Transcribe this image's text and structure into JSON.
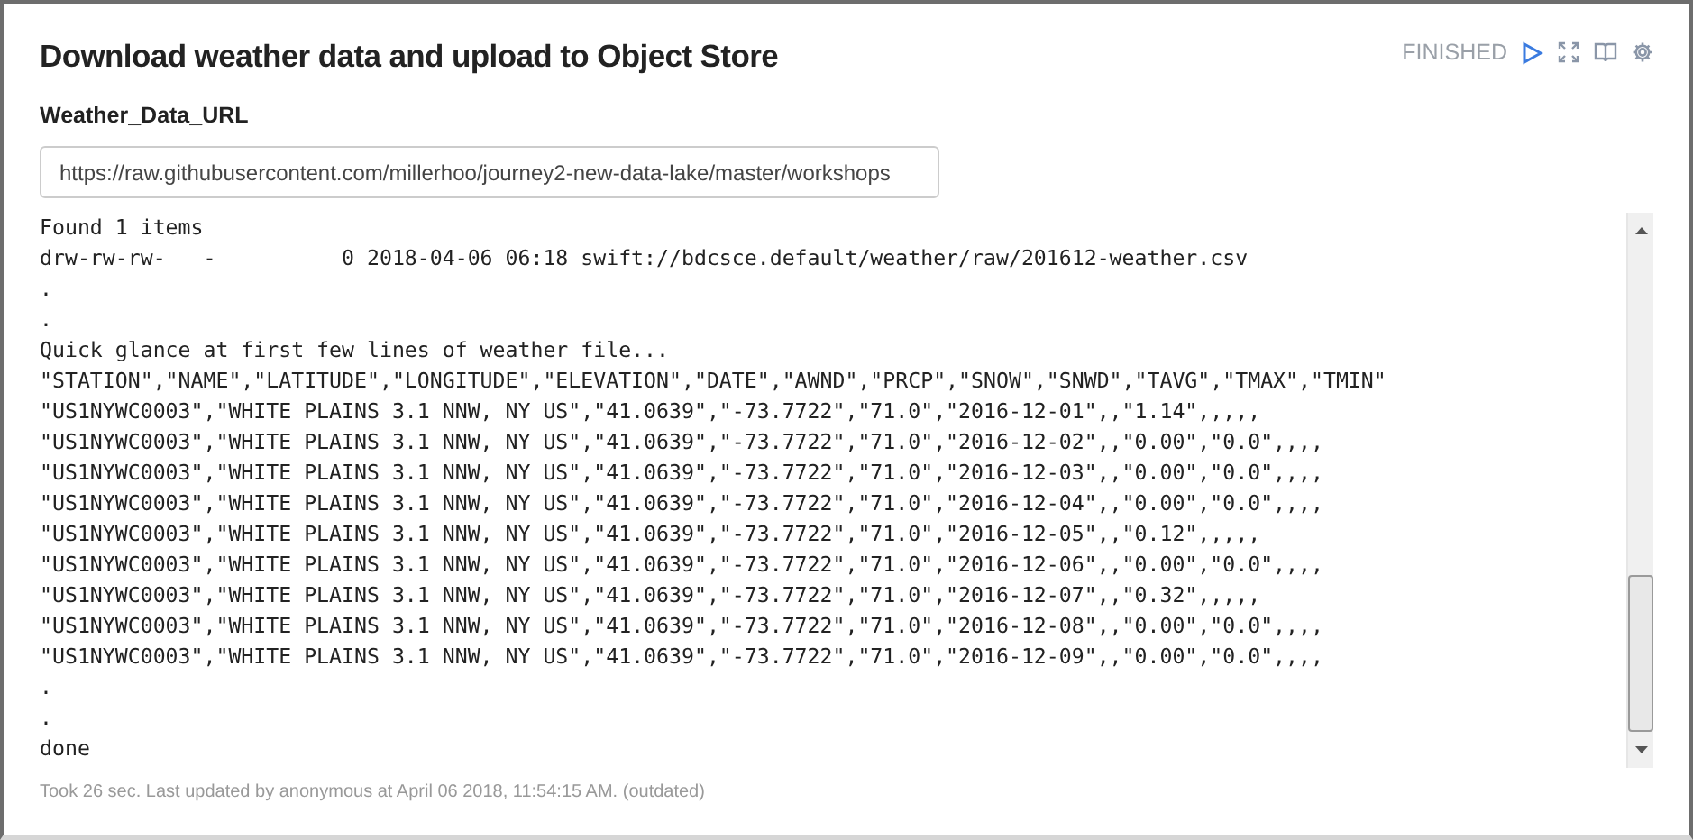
{
  "paragraph": {
    "title": "Download weather data and upload to Object Store",
    "status": "FINISHED"
  },
  "param": {
    "label": "Weather_Data_URL",
    "value": "https://raw.githubusercontent.com/millerhoo/journey2-new-data-lake/master/workshops"
  },
  "output": {
    "lines": [
      "Found 1 items",
      "drw-rw-rw-   -          0 2018-04-06 06:18 swift://bdcsce.default/weather/raw/201612-weather.csv",
      ".",
      ".",
      "Quick glance at first few lines of weather file...",
      "\"STATION\",\"NAME\",\"LATITUDE\",\"LONGITUDE\",\"ELEVATION\",\"DATE\",\"AWND\",\"PRCP\",\"SNOW\",\"SNWD\",\"TAVG\",\"TMAX\",\"TMIN\"",
      "\"US1NYWC0003\",\"WHITE PLAINS 3.1 NNW, NY US\",\"41.0639\",\"-73.7722\",\"71.0\",\"2016-12-01\",,\"1.14\",,,,,",
      "\"US1NYWC0003\",\"WHITE PLAINS 3.1 NNW, NY US\",\"41.0639\",\"-73.7722\",\"71.0\",\"2016-12-02\",,\"0.00\",\"0.0\",,,,",
      "\"US1NYWC0003\",\"WHITE PLAINS 3.1 NNW, NY US\",\"41.0639\",\"-73.7722\",\"71.0\",\"2016-12-03\",,\"0.00\",\"0.0\",,,,",
      "\"US1NYWC0003\",\"WHITE PLAINS 3.1 NNW, NY US\",\"41.0639\",\"-73.7722\",\"71.0\",\"2016-12-04\",,\"0.00\",\"0.0\",,,,",
      "\"US1NYWC0003\",\"WHITE PLAINS 3.1 NNW, NY US\",\"41.0639\",\"-73.7722\",\"71.0\",\"2016-12-05\",,\"0.12\",,,,,",
      "\"US1NYWC0003\",\"WHITE PLAINS 3.1 NNW, NY US\",\"41.0639\",\"-73.7722\",\"71.0\",\"2016-12-06\",,\"0.00\",\"0.0\",,,,",
      "\"US1NYWC0003\",\"WHITE PLAINS 3.1 NNW, NY US\",\"41.0639\",\"-73.7722\",\"71.0\",\"2016-12-07\",,\"0.32\",,,,,",
      "\"US1NYWC0003\",\"WHITE PLAINS 3.1 NNW, NY US\",\"41.0639\",\"-73.7722\",\"71.0\",\"2016-12-08\",,\"0.00\",\"0.0\",,,,",
      "\"US1NYWC0003\",\"WHITE PLAINS 3.1 NNW, NY US\",\"41.0639\",\"-73.7722\",\"71.0\",\"2016-12-09\",,\"0.00\",\"0.0\",,,,",
      ".",
      ".",
      "done"
    ]
  },
  "footer": "Took 26 sec. Last updated by anonymous at April 06 2018, 11:54:15 AM. (outdated)"
}
